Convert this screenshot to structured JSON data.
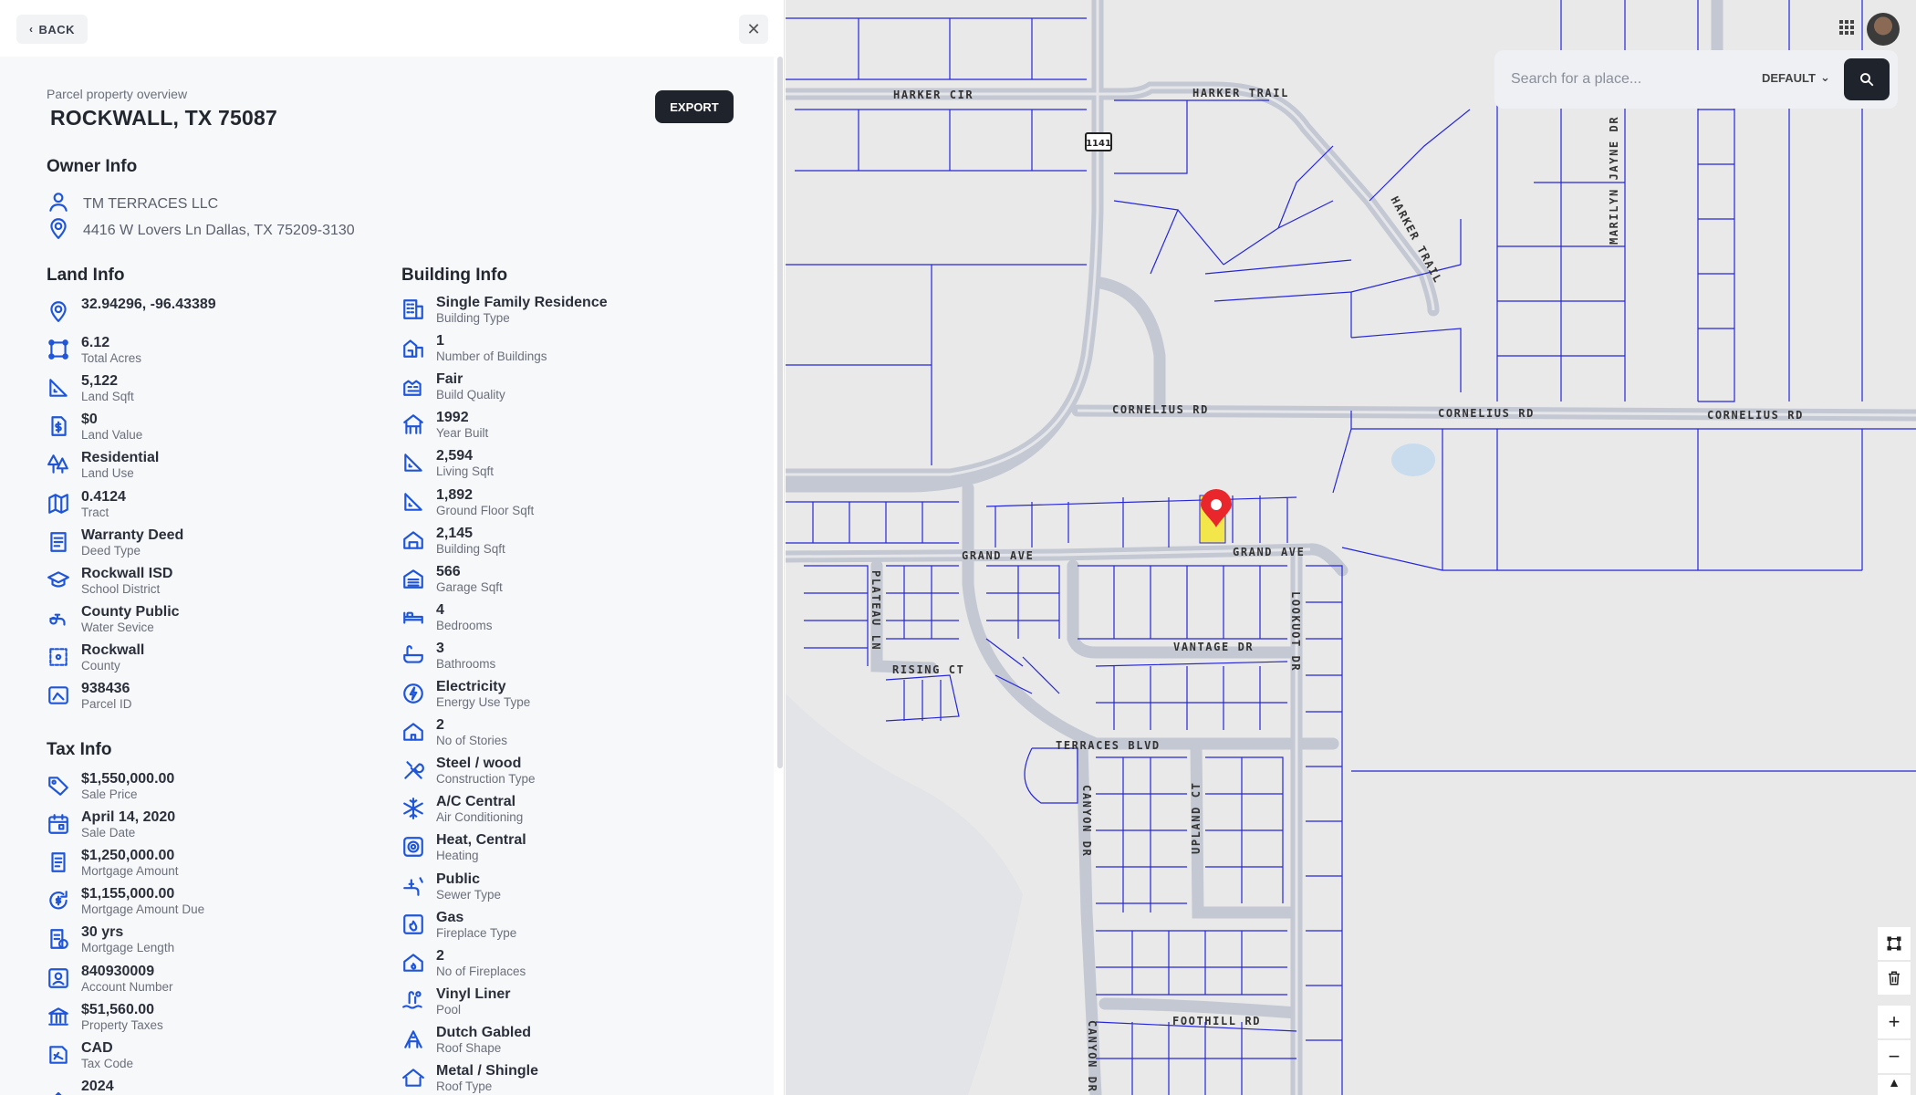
{
  "topbar": {
    "back_label": "BACK"
  },
  "header": {
    "subtitle": "Parcel property overview",
    "address": "ROCKWALL, TX 75087",
    "export_label": "EXPORT"
  },
  "owner": {
    "title": "Owner Info",
    "name": "TM TERRACES LLC",
    "address": "4416 W Lovers Ln Dallas,  TX 75209-3130"
  },
  "land": {
    "title": "Land Info",
    "items": [
      {
        "value": "32.94296, -96.43389",
        "label": "",
        "icon": "location-pin-icon"
      },
      {
        "value": "6.12",
        "label": "Total Acres",
        "icon": "area-icon"
      },
      {
        "value": "5,122",
        "label": "Land Sqft",
        "icon": "ruler-triangle-icon"
      },
      {
        "value": "$0",
        "label": "Land Value",
        "icon": "dollar-document-icon"
      },
      {
        "value": "Residential",
        "label": "Land Use",
        "icon": "trees-icon"
      },
      {
        "value": "0.4124",
        "label": "Tract",
        "icon": "map-icon"
      },
      {
        "value": "Warranty Deed",
        "label": "Deed Type",
        "icon": "deed-icon"
      },
      {
        "value": "Rockwall ISD",
        "label": "School District",
        "icon": "school-icon"
      },
      {
        "value": "County Public",
        "label": "Water Sevice",
        "icon": "faucet-icon"
      },
      {
        "value": "Rockwall",
        "label": "County",
        "icon": "county-icon"
      },
      {
        "value": "938436",
        "label": "Parcel ID",
        "icon": "parcel-id-icon"
      }
    ]
  },
  "tax": {
    "title": "Tax Info",
    "items": [
      {
        "value": "$1,550,000.00",
        "label": "Sale Price",
        "icon": "price-tag-icon"
      },
      {
        "value": "April 14, 2020",
        "label": "Sale Date",
        "icon": "calendar-icon"
      },
      {
        "value": "$1,250,000.00",
        "label": "Mortgage Amount",
        "icon": "mortgage-document-icon"
      },
      {
        "value": "$1,155,000.00",
        "label": "Mortgage Amount Due",
        "icon": "refresh-dollar-icon"
      },
      {
        "value": "30 yrs",
        "label": "Mortgage Length",
        "icon": "document-clock-icon"
      },
      {
        "value": "840930009",
        "label": "Account Number",
        "icon": "account-icon"
      },
      {
        "value": "$51,560.00",
        "label": "Property Taxes",
        "icon": "bank-icon"
      },
      {
        "value": "CAD",
        "label": "Tax Code",
        "icon": "tax-code-icon"
      },
      {
        "value": "2024",
        "label": "",
        "icon": "tax-year-icon"
      }
    ]
  },
  "building": {
    "title": "Building Info",
    "items": [
      {
        "value": "Single Family Residence",
        "label": "Building Type",
        "icon": "building-icon"
      },
      {
        "value": "1",
        "label": "Number of Buildings",
        "icon": "buildings-count-icon"
      },
      {
        "value": "Fair",
        "label": "Build Quality",
        "icon": "quality-icon"
      },
      {
        "value": "1992",
        "label": "Year Built",
        "icon": "construction-year-icon"
      },
      {
        "value": "2,594",
        "label": "Living Sqft",
        "icon": "ruler-triangle-icon"
      },
      {
        "value": "1,892",
        "label": "Ground Floor Sqft",
        "icon": "ruler-triangle-icon"
      },
      {
        "value": "2,145",
        "label": "Building Sqft",
        "icon": "house-area-icon"
      },
      {
        "value": "566",
        "label": "Garage Sqft",
        "icon": "garage-icon"
      },
      {
        "value": "4",
        "label": "Bedrooms",
        "icon": "bed-icon"
      },
      {
        "value": "3",
        "label": "Bathrooms",
        "icon": "bathtub-icon"
      },
      {
        "value": "Electricity",
        "label": "Energy Use Type",
        "icon": "energy-icon"
      },
      {
        "value": "2",
        "label": "No of Stories",
        "icon": "house-icon"
      },
      {
        "value": "Steel / wood",
        "label": "Construction Type",
        "icon": "tools-icon"
      },
      {
        "value": "A/C Central",
        "label": "Air Conditioning",
        "icon": "snowflake-icon"
      },
      {
        "value": "Heat, Central",
        "label": "Heating",
        "icon": "heater-icon"
      },
      {
        "value": "Public",
        "label": "Sewer Type",
        "icon": "sewer-icon"
      },
      {
        "value": "Gas",
        "label": "Fireplace Type",
        "icon": "fireplace-icon"
      },
      {
        "value": "2",
        "label": "No of Fireplaces",
        "icon": "house-fireplace-icon"
      },
      {
        "value": "Vinyl Liner",
        "label": "Pool",
        "icon": "pool-icon"
      },
      {
        "value": "Dutch Gabled",
        "label": "Roof Shape",
        "icon": "roof-shape-icon"
      },
      {
        "value": "Metal / Shingle",
        "label": "Roof Type",
        "icon": "roof-type-icon"
      }
    ]
  },
  "map": {
    "search_placeholder": "Search for a place...",
    "style_label": "DEFAULT",
    "roads": [
      "HARKER CIR",
      "HARKER TRAIL",
      "HARKER TRAIL",
      "MARILYN JAYNE DR",
      "CORNELIUS RD",
      "CORNELIUS RD",
      "CORNELIUS RD",
      "GRAND AVE",
      "GRAND AVE",
      "PLATEAU LN",
      "LOOKUOT DR",
      "VANTAGE DR",
      "RISING CT",
      "TERRACES BLVD",
      "CANYON DR",
      "UPLAND CT",
      "FOOTHILL RD",
      "CANYON DR"
    ],
    "highway_shield": "1141",
    "parcel_highlight_color": "#f2e64a",
    "marker_color": "#e8262b",
    "parcel_line_color": "#2626d9"
  }
}
